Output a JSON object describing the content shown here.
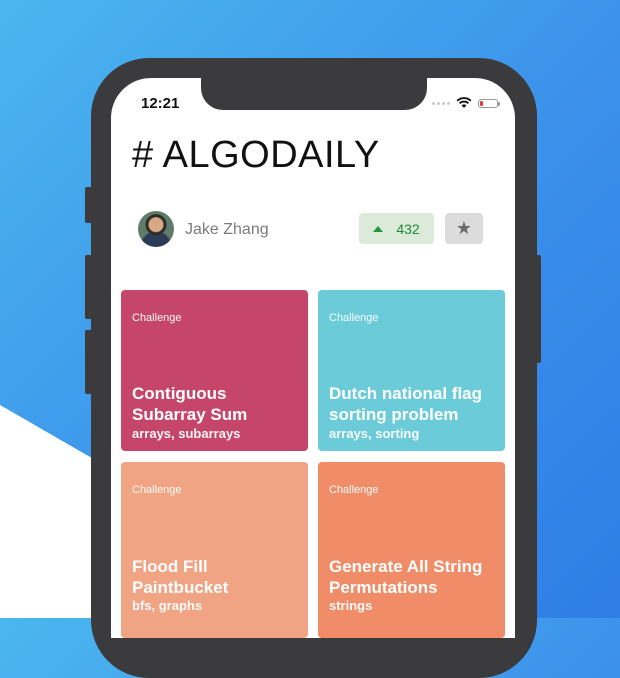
{
  "status_bar": {
    "time": "12:21"
  },
  "app": {
    "title": "# ALGODAILY"
  },
  "user": {
    "name": "Jake Zhang",
    "upvotes": "432"
  },
  "cards": [
    {
      "kind": "Challenge",
      "title_line1": "Contiguous",
      "title_line2": "Subarray Sum",
      "tags": "arrays, subarrays",
      "color": "#c5466a"
    },
    {
      "kind": "Challenge",
      "title_line1": "Dutch national flag",
      "title_line2": "sorting problem",
      "tags": "arrays, sorting",
      "color": "#6bcbd8"
    },
    {
      "kind": "Challenge",
      "title_line1": "Flood Fill",
      "title_line2": "Paintbucket",
      "tags": "bfs, graphs",
      "color": "#f0a483"
    },
    {
      "kind": "Challenge",
      "title_line1": "Generate All String",
      "title_line2": "Permutations",
      "tags": "strings",
      "color": "#f08d68"
    }
  ],
  "icons": {
    "signal": "signal-dots-icon",
    "wifi": "wifi-icon",
    "battery": "battery-icon",
    "upvote": "upvote-arrow-icon",
    "star": "star-icon"
  }
}
